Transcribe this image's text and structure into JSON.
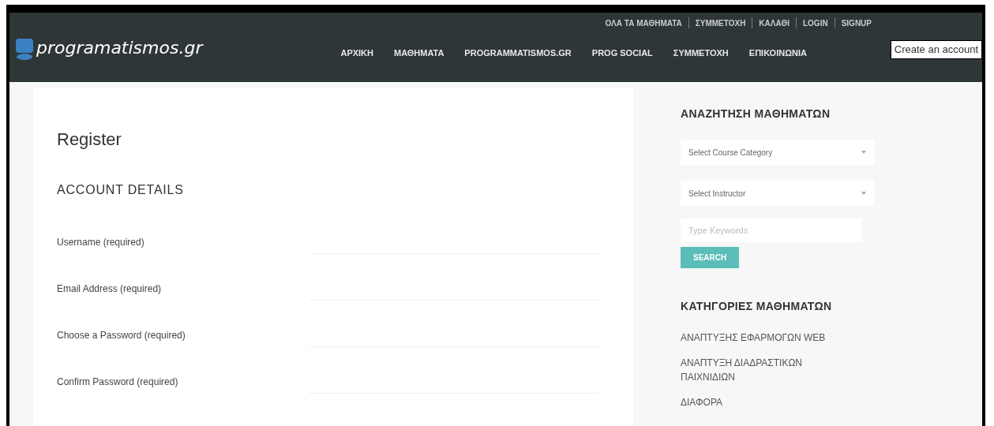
{
  "header": {
    "logo": "programatismos.gr",
    "top_links": [
      "ΟΛΑ ΤΑ ΜΑΘΗΜΑΤΑ",
      "ΣΥΜΜΕΤΟΧΗ",
      "ΚΑΛΑΘΙ",
      "LOGIN",
      "SIGNUP"
    ],
    "nav": [
      "ΑΡΧΙΚΗ",
      "ΜΑΘΗΜΑΤΑ",
      "PROGRAMMATISMOS.GR",
      "PROG SOCIAL",
      "ΣΥΜΜΕΤΟΧΗ",
      "ΕΠΙΚΟΙΝΩΝΙΑ"
    ],
    "tooltip": "Create an account"
  },
  "form": {
    "title": "Register",
    "section": "ACCOUNT DETAILS",
    "fields": [
      {
        "label": "Username (required)"
      },
      {
        "label": "Email Address (required)"
      },
      {
        "label": "Choose a Password (required)"
      },
      {
        "label": "Confirm Password (required)"
      }
    ]
  },
  "sidebar": {
    "search_title": "ΑΝΑΖΗΤΗΣΗ ΜΑΘΗΜΑΤΩΝ",
    "selects": [
      "Select Course Category",
      "Select Instructor"
    ],
    "keywords": {
      "placeholder": "Type Keywords"
    },
    "button": "SEARCH",
    "categories_title": "ΚΑΤΗΓΟΡΙΕΣ ΜΑΘΗΜΑΤΩΝ",
    "categories": [
      "ΑΝΑΠΤΥΞΗΣ ΕΦΑΡΜΟΓΩΝ WEB",
      "ΑΝΑΠΤΥΞΗ ΔΙΑΔΡΑΣΤΙΚΩΝ ΠΑΙΧΝΙΔΙΩΝ",
      "ΔΙΑΦΟΡΑ"
    ]
  }
}
